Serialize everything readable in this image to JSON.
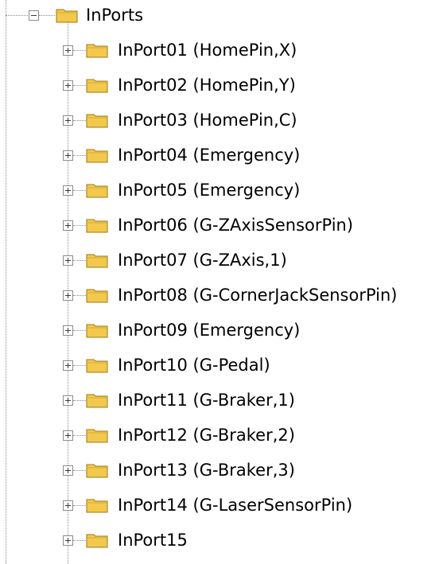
{
  "tree": {
    "root": {
      "label": "InPorts",
      "expanded": true,
      "icon": "folder-icon"
    },
    "items": [
      {
        "label": "InPort01 (HomePin,X)",
        "icon": "folder-icon",
        "expanded": false
      },
      {
        "label": "InPort02 (HomePin,Y)",
        "icon": "folder-icon",
        "expanded": false
      },
      {
        "label": "InPort03 (HomePin,C)",
        "icon": "folder-icon",
        "expanded": false
      },
      {
        "label": "InPort04 (Emergency)",
        "icon": "folder-icon",
        "expanded": false
      },
      {
        "label": "InPort05 (Emergency)",
        "icon": "folder-icon",
        "expanded": false
      },
      {
        "label": "InPort06 (G-ZAxisSensorPin)",
        "icon": "folder-icon",
        "expanded": false
      },
      {
        "label": "InPort07 (G-ZAxis,1)",
        "icon": "folder-icon",
        "expanded": false
      },
      {
        "label": "InPort08 (G-CornerJackSensorPin)",
        "icon": "folder-icon",
        "expanded": false
      },
      {
        "label": "InPort09 (Emergency)",
        "icon": "folder-icon",
        "expanded": false
      },
      {
        "label": "InPort10 (G-Pedal)",
        "icon": "folder-icon",
        "expanded": false
      },
      {
        "label": "InPort11 (G-Braker,1)",
        "icon": "folder-icon",
        "expanded": false
      },
      {
        "label": "InPort12 (G-Braker,2)",
        "icon": "folder-icon",
        "expanded": false
      },
      {
        "label": "InPort13 (G-Braker,3)",
        "icon": "folder-icon",
        "expanded": false
      },
      {
        "label": "InPort14 (G-LaserSensorPin)",
        "icon": "folder-icon",
        "expanded": false
      },
      {
        "label": "InPort15",
        "icon": "folder-icon",
        "expanded": false
      }
    ]
  },
  "colors": {
    "guide_line": "#8c8c8c",
    "folder_fill": "#f2c94c",
    "folder_edge": "#9a7a1a"
  }
}
